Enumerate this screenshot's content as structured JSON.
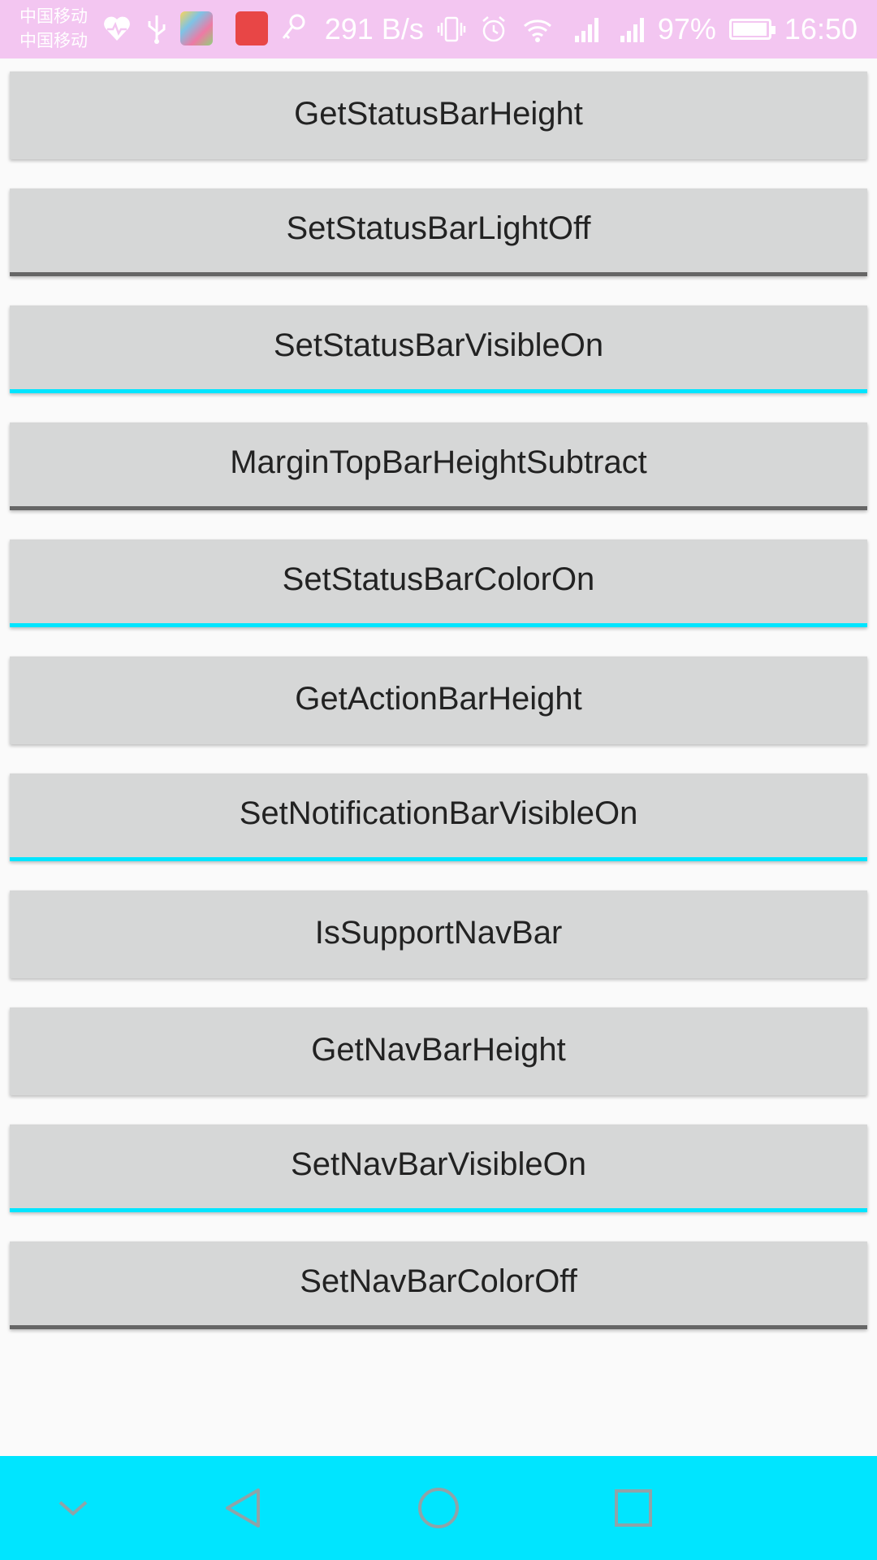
{
  "status_bar": {
    "carrier_1": "中国移动",
    "carrier_2": "中国移动",
    "net_speed": "291 B/s",
    "battery_percent": "97%",
    "battery_level": 0.97,
    "time": "16:50",
    "icons": [
      "heart-rate-icon",
      "usb-icon",
      "app-icon",
      "paper-plane-icon",
      "fire-app-icon",
      "key-icon",
      "vibrate-icon",
      "alarm-icon",
      "wifi-icon",
      "signal-2g-icon",
      "signal-4g-icon",
      "battery-icon"
    ],
    "bg_color": "#f3c6f1"
  },
  "buttons": [
    {
      "label": "GetStatusBarHeight",
      "indicator": "none"
    },
    {
      "label": "SetStatusBarLightOff",
      "indicator": "dark"
    },
    {
      "label": "SetStatusBarVisibleOn",
      "indicator": "cyan"
    },
    {
      "label": "MarginTopBarHeightSubtract",
      "indicator": "dark"
    },
    {
      "label": "SetStatusBarColorOn",
      "indicator": "cyan"
    },
    {
      "label": "GetActionBarHeight",
      "indicator": "none"
    },
    {
      "label": "SetNotificationBarVisibleOn",
      "indicator": "cyan"
    },
    {
      "label": "IsSupportNavBar",
      "indicator": "none"
    },
    {
      "label": "GetNavBarHeight",
      "indicator": "none"
    },
    {
      "label": "SetNavBarVisibleOn",
      "indicator": "cyan"
    },
    {
      "label": "SetNavBarColorOff",
      "indicator": "dark"
    }
  ],
  "nav_bar": {
    "bg_color": "#00e5ff",
    "items": [
      "collapse-chevron-icon",
      "back-triangle-icon",
      "home-circle-icon",
      "recents-square-icon"
    ]
  },
  "colors": {
    "button_bg": "#d6d7d7",
    "indicator_dark": "#666666",
    "indicator_cyan": "#00e5ff",
    "page_bg": "#fafafa"
  }
}
